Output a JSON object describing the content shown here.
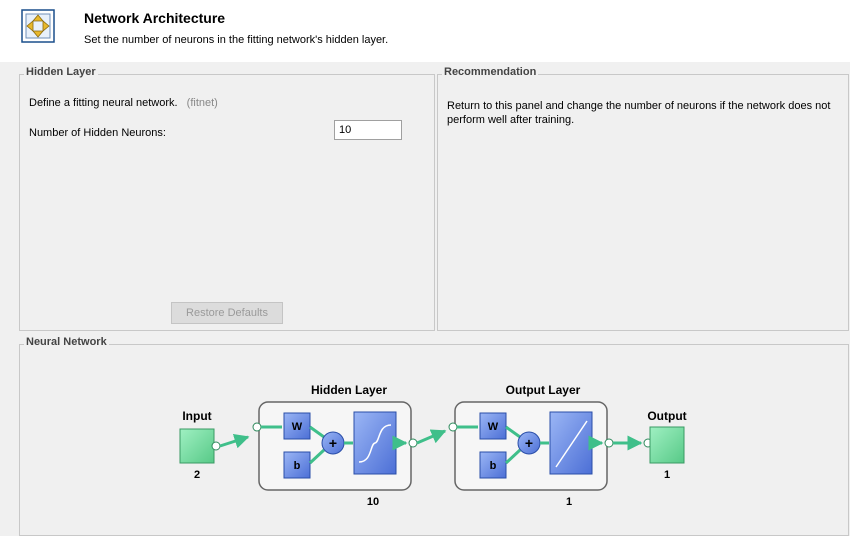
{
  "header": {
    "title": "Network Architecture",
    "subtitle": "Set the number of neurons in the fitting network's hidden layer.",
    "icon": "network-architecture-icon"
  },
  "hidden_layer": {
    "title": "Hidden Layer",
    "description": "Define a fitting neural network.",
    "description_sub": "(fitnet)",
    "neurons_label": "Number of Hidden Neurons:",
    "neurons_value": "10",
    "restore_button": "Restore Defaults"
  },
  "recommendation": {
    "title": "Recommendation",
    "text": "Return to this panel and change the number of neurons if the network does not perform well after training."
  },
  "neural_network": {
    "title": "Neural Network",
    "input_label": "Input",
    "input_size": "2",
    "hidden_title": "Hidden Layer",
    "hidden_size": "10",
    "output_layer_title": "Output Layer",
    "output_layer_size": "1",
    "output_label": "Output",
    "output_size": "1",
    "weight_label": "W",
    "bias_label": "b"
  },
  "colors": {
    "io_block": "#7fe0a8",
    "weight_block": "#6d8ee6",
    "connector": "#3fbf8a"
  }
}
